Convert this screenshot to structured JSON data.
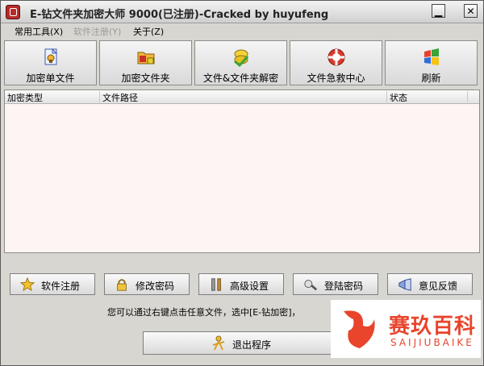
{
  "window": {
    "title": "E-钻文件夹加密大师 9000(已注册)-Cracked by huyufeng",
    "minimize_glyph": "▁",
    "close_glyph": "✕"
  },
  "menu": [
    {
      "label": "常用工具(X)",
      "disabled": false
    },
    {
      "label": "软件注册(Y)",
      "disabled": true
    },
    {
      "label": "关于(Z)",
      "disabled": false
    }
  ],
  "toolbar": [
    {
      "label": "加密单文件",
      "icon": "encrypt-file-icon"
    },
    {
      "label": "加密文件夹",
      "icon": "encrypt-folder-icon"
    },
    {
      "label": "文件&文件夹解密",
      "icon": "decrypt-icon"
    },
    {
      "label": "文件急救中心",
      "icon": "lifebuoy-icon"
    },
    {
      "label": "刷新",
      "icon": "windows-flag-icon"
    }
  ],
  "list": {
    "columns": [
      "加密类型",
      "文件路径",
      "状态"
    ],
    "rows": []
  },
  "bottom_buttons": [
    {
      "label": "软件注册",
      "icon": "star-icon"
    },
    {
      "label": "修改密码",
      "icon": "lock-icon"
    },
    {
      "label": "高级设置",
      "icon": "tools-icon"
    },
    {
      "label": "登陆密码",
      "icon": "key-icon"
    },
    {
      "label": "意见反馈",
      "icon": "feedback-icon"
    }
  ],
  "hint": "您可以通过右键点击任意文件，选中[E-钻加密]，",
  "exit_label": "退出程序",
  "watermark": {
    "cn": "赛玖百科",
    "en": "SAIJIUBAIKE"
  },
  "colors": {
    "list_bg": "#fdf4f4",
    "watermark": "#e8452c"
  }
}
